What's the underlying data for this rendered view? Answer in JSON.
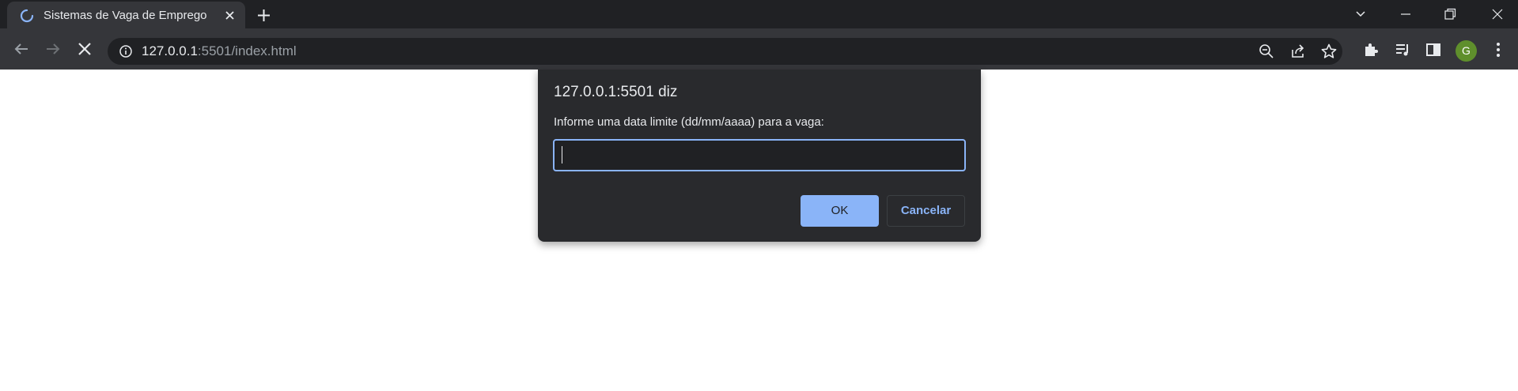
{
  "browser": {
    "tab": {
      "title": "Sistemas de Vaga de Emprego",
      "spinner_icon": "loading-spinner-icon",
      "close_icon": "close-icon"
    },
    "new_tab_icon": "plus-icon",
    "window_controls": [
      "tab-search-icon",
      "minimize-icon",
      "restore-icon",
      "close-window-icon"
    ],
    "address_bar": {
      "host": "127.0.0.1",
      "rest": ":5501/index.html",
      "info_icon": "info-icon",
      "zoom_icon": "zoom-out-icon",
      "share_icon": "share-icon",
      "bookmark_icon": "star-icon"
    },
    "nav": {
      "back_icon": "back-arrow-icon",
      "forward_icon": "forward-arrow-icon",
      "stop_icon": "stop-loading-icon"
    },
    "extensions": [
      "puzzle-icon",
      "media-queue-icon",
      "side-panel-icon"
    ],
    "profile_initial": "G",
    "menu_icon": "kebab-menu-icon"
  },
  "dialog": {
    "title": "127.0.0.1:5501 diz",
    "message": "Informe uma data limite (dd/mm/aaaa) para a vaga:",
    "input_value": "",
    "ok_label": "OK",
    "cancel_label": "Cancelar"
  },
  "colors": {
    "tabstrip_bg": "#202124",
    "toolbar_bg": "#35363a",
    "dialog_bg": "#292a2d",
    "accent": "#8ab4f8",
    "avatar": "#5f8f2c"
  }
}
